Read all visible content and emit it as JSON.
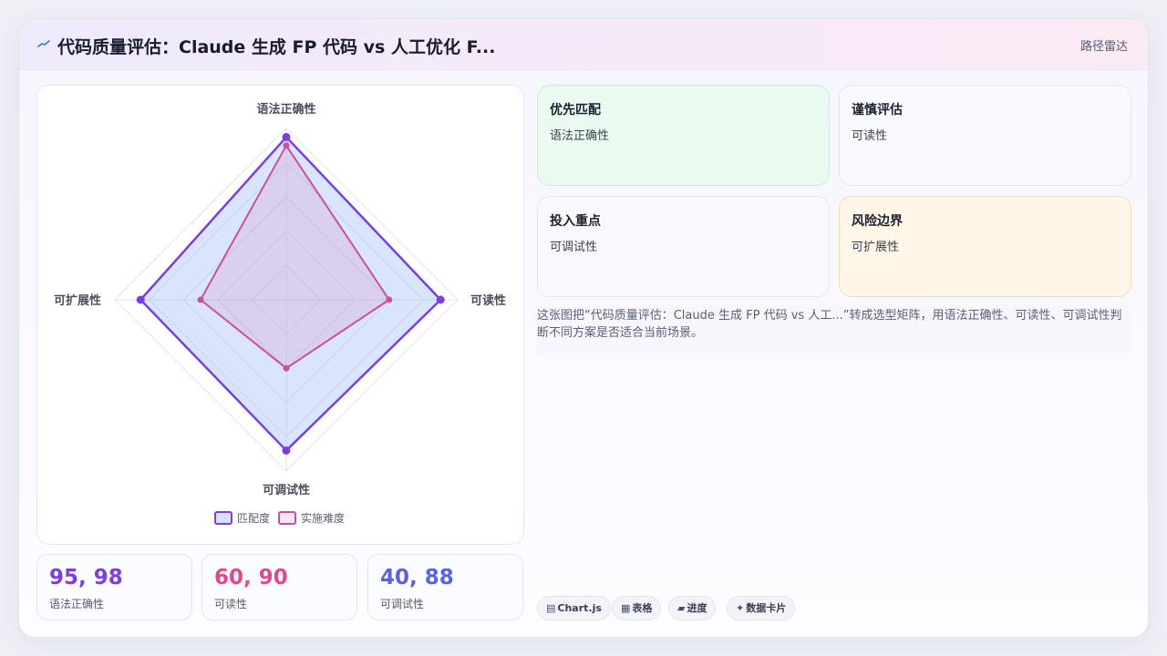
{
  "header": {
    "title": "代码质量评估：Claude 生成 FP 代码 vs 人工优化 F...",
    "badge": "路径雷达"
  },
  "chart_data": {
    "type": "radar",
    "axes": [
      "语法正确性",
      "可读性",
      "可调试性",
      "可扩展性"
    ],
    "series": [
      {
        "name": "匹配度",
        "values": [
          95,
          90,
          88,
          85
        ],
        "color": "#7b3fe0"
      },
      {
        "name": "实施难度",
        "values": [
          90,
          60,
          40,
          50
        ],
        "color": "#c94fa3"
      }
    ],
    "range": [
      0,
      100
    ]
  },
  "stats": [
    {
      "value": "95, 98",
      "label": "语法正确性",
      "color": "#7b3fe0"
    },
    {
      "value": "60, 90",
      "label": "可读性",
      "color": "#e0488f"
    },
    {
      "value": "40, 88",
      "label": "可调试性",
      "color": "#5b62de"
    }
  ],
  "quadrants": [
    {
      "title": "优先匹配",
      "body": "语法正确性"
    },
    {
      "title": "谨慎评估",
      "body": "可读性"
    },
    {
      "title": "投入重点",
      "body": "可调试性"
    },
    {
      "title": "风险边界",
      "body": "可扩展性"
    }
  ],
  "description": "这张图把“代码质量评估：Claude 生成 FP 代码 vs 人工...”转成选型矩阵，用语法正确性、可读性、可调试性判断不同方案是否适合当前场景。",
  "tags": [
    {
      "icon": "▤",
      "label": "Chart.js"
    },
    {
      "icon": "▦",
      "label": "表格"
    },
    {
      "icon": "▰",
      "label": "进度"
    },
    {
      "icon": "✦",
      "label": "数据卡片"
    }
  ]
}
